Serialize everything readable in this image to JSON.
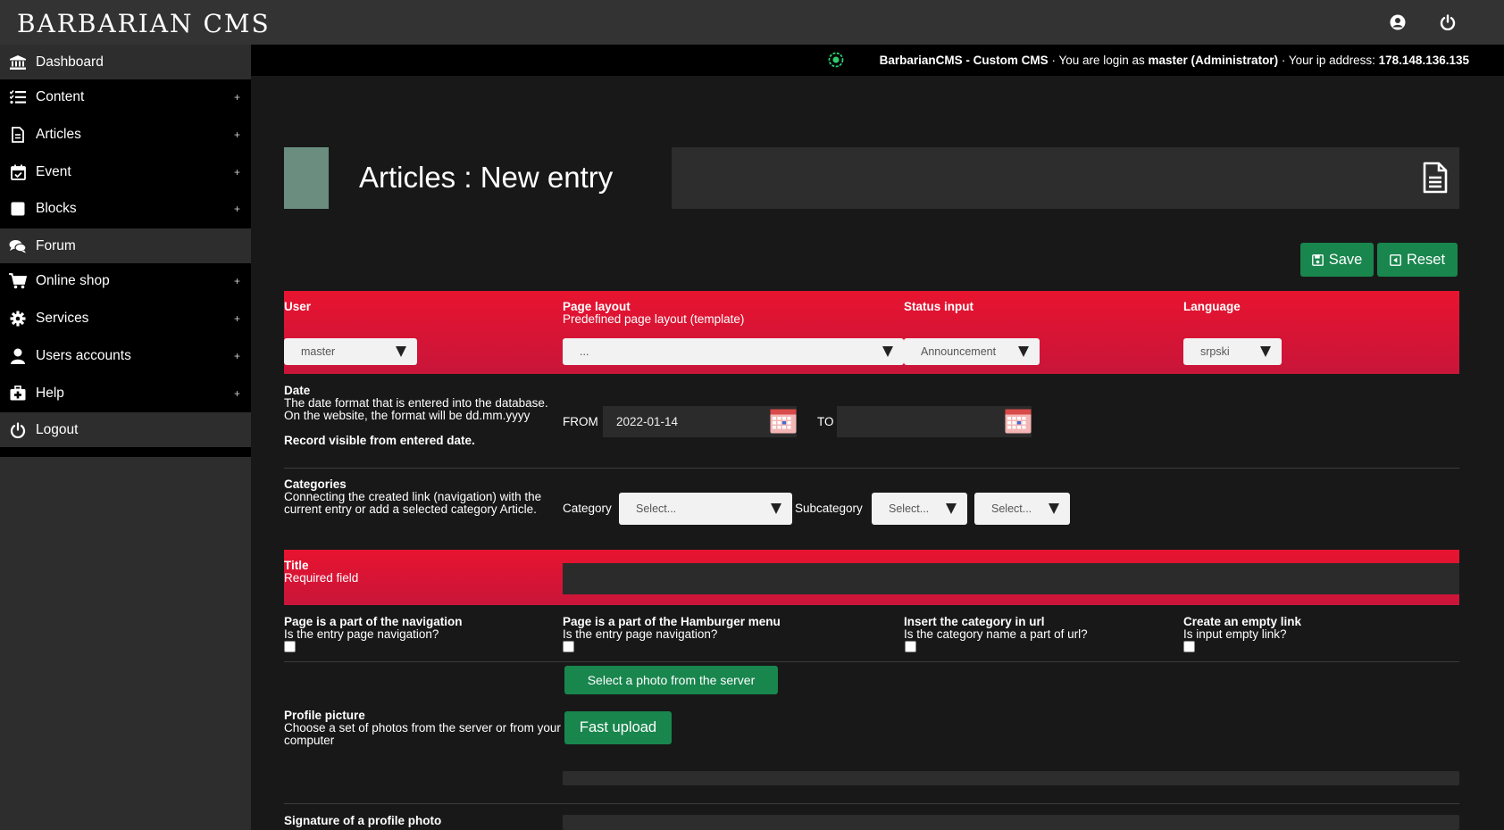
{
  "app": {
    "logo": "BARBARIAN CMS"
  },
  "topbar": {
    "user_icon": "user-circle-icon",
    "power_icon": "power-icon"
  },
  "sidebar": {
    "items": [
      {
        "label": "Dashboard",
        "icon": "bank-icon",
        "expand": ""
      },
      {
        "label": "Content",
        "icon": "list-check-icon",
        "expand": "+"
      },
      {
        "label": "Articles",
        "icon": "file-icon",
        "expand": "+"
      },
      {
        "label": "Event",
        "icon": "calendar-check-icon",
        "expand": "+"
      },
      {
        "label": "Blocks",
        "icon": "square-icon",
        "expand": "+"
      },
      {
        "label": "Forum",
        "icon": "comments-icon",
        "expand": ""
      },
      {
        "label": "Online shop",
        "icon": "cart-icon",
        "expand": "+"
      },
      {
        "label": "Services",
        "icon": "gear-icon",
        "expand": "+"
      },
      {
        "label": "Users accounts",
        "icon": "user-icon",
        "expand": "+"
      },
      {
        "label": "Help",
        "icon": "medkit-icon",
        "expand": "+"
      },
      {
        "label": "Logout",
        "icon": "power-icon",
        "expand": ""
      }
    ]
  },
  "infobar": {
    "site": "BarbarianCMS - Custom CMS",
    "sep1": " · You are login as ",
    "user": "master (Administrator)",
    "sep2": " · Your ip address: ",
    "ip": "178.148.136.135"
  },
  "header": {
    "title": "Articles : New entry"
  },
  "actions": {
    "save": "Save",
    "reset": "Reset"
  },
  "form": {
    "user": {
      "label": "User",
      "value": "master"
    },
    "page_layout": {
      "label": "Page layout",
      "sub": "Predefined page layout (template)",
      "value": "..."
    },
    "status": {
      "label": "Status input",
      "value": "Announcement"
    },
    "language": {
      "label": "Language",
      "value": "srpski"
    },
    "date": {
      "label": "Date",
      "desc": "The date format that is entered into the database. On the website, the format will be dd.mm.yyyy",
      "note": "Record visible from entered date.",
      "from_label": "FROM",
      "from_value": "2022-01-14",
      "to_label": "TO",
      "to_value": ""
    },
    "categories": {
      "label": "Categories",
      "desc": "Connecting the created link (navigation) with the current entry or add a selected category Article.",
      "category_label": "Category",
      "category_value": "Select...",
      "subcategory_label": "Subcategory",
      "subcategory_value": "Select...",
      "third_value": "Select..."
    },
    "title": {
      "label": "Title",
      "sub": "Required field",
      "value": ""
    },
    "flags": [
      {
        "label": "Page is a part of the navigation",
        "sub": "Is the entry page navigation?"
      },
      {
        "label": "Page is a part of the Hamburger menu",
        "sub": "Is the entry page navigation?"
      },
      {
        "label": "Insert the category in url",
        "sub": "Is the category name a part of url?"
      },
      {
        "label": "Create an empty link",
        "sub": "Is input empty link?"
      }
    ],
    "photo": {
      "select_button": "Select a photo from the server",
      "label": "Profile picture",
      "desc": "Choose a set of photos from the server or from your computer",
      "upload_button": "Fast upload"
    },
    "signature": {
      "label": "Signature of a profile photo"
    }
  },
  "colors": {
    "accent_red": "#e8142f",
    "green": "#19864e",
    "header_square": "#6a8d7f"
  }
}
